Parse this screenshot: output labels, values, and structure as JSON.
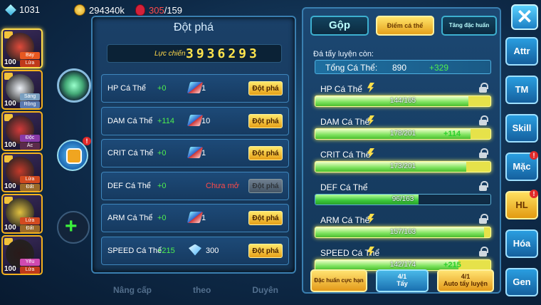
{
  "resources": {
    "gems": "1031",
    "gold": "294340k",
    "energy_current": "305",
    "energy_max": "/159"
  },
  "team": [
    {
      "level": "100",
      "tag1": "Bay",
      "tag2": "Lửa",
      "color1": "#e85820",
      "color2": "#c03a1a",
      "avatar": "#e04a3a"
    },
    {
      "level": "100",
      "tag1": "Sáng",
      "tag2": "Rồng",
      "color1": "#7aa0c0",
      "color2": "#5a7ab0",
      "avatar": "#eef2f8"
    },
    {
      "level": "100",
      "tag1": "Độc",
      "tag2": "Ác",
      "color1": "#8a3aa8",
      "color2": "#5a2a4a",
      "avatar": "#d23a3a"
    },
    {
      "level": "100",
      "tag1": "Lửa",
      "tag2": "Đất",
      "color1": "#d24a20",
      "color2": "#9a6a2a",
      "avatar": "#c43a2a"
    },
    {
      "level": "100",
      "tag1": "Lửa",
      "tag2": "Đất",
      "color1": "#d24a20",
      "color2": "#9a6a2a",
      "avatar": "#e0c040"
    },
    {
      "level": "100",
      "tag1": "Yêu",
      "tag2": "Lửa",
      "color1": "#d04ab0",
      "color2": "#c03a1a",
      "avatar": "#2a1a1a"
    }
  ],
  "bag_notif": "!",
  "bottom_faded": [
    "Nâng cấp",
    "theo",
    "Duyên"
  ],
  "breakthrough": {
    "title": "Đột phá",
    "power_label": "Lực chiến",
    "power_value": "3936293",
    "rows": [
      {
        "stat": "HP Cá Thể",
        "inc": "+0",
        "cost_icon": "scroll-icon",
        "cost": "1",
        "button": "Đột phá",
        "locked": false
      },
      {
        "stat": "DAM Cá Thể",
        "inc": "+114",
        "cost_icon": "scroll-icon",
        "cost": "10",
        "button": "Đột phá",
        "locked": false
      },
      {
        "stat": "CRIT Cá Thể",
        "inc": "+0",
        "cost_icon": "scroll-icon",
        "cost": "1",
        "button": "Đột phá",
        "locked": false
      },
      {
        "stat": "DEF Cá Thể",
        "inc": "+0",
        "cost_icon": "",
        "cost": "",
        "locked_text": "Chưa mở",
        "button": "Đột phá",
        "locked": true
      },
      {
        "stat": "ARM Cá Thể",
        "inc": "+0",
        "cost_icon": "scroll-icon",
        "cost": "1",
        "button": "Đột phá",
        "locked": false
      },
      {
        "stat": "SPEED Cá Thể",
        "inc": "+215",
        "cost_icon": "diamond-icon",
        "cost": "300",
        "button": "Đột phá",
        "locked": false
      }
    ]
  },
  "stats_panel": {
    "tabs": {
      "merge": "Gộp",
      "individual": "Điểm cá thể",
      "special": "Tăng đặc huấn"
    },
    "points_label": "Đá tẩy luyện còn:",
    "total_label": "Tổng Cá Thể:",
    "total_value": "890",
    "total_gain": "+329",
    "stats": [
      {
        "name": "HP Cá Thể",
        "value": "144/165",
        "ratio": 0.873,
        "add": "",
        "boost": true
      },
      {
        "name": "DAM Cá Thể",
        "value": "178/201",
        "ratio": 0.886,
        "add": "+114",
        "boost": true
      },
      {
        "name": "CRIT Cá Thể",
        "value": "173/201",
        "ratio": 0.861,
        "add": "",
        "boost": true
      },
      {
        "name": "DEF Cá Thể",
        "value": "96/163",
        "ratio": 0.589,
        "add": "",
        "boost": false
      },
      {
        "name": "ARM Cá Thể",
        "value": "157/163",
        "ratio": 0.963,
        "add": "",
        "boost": true
      },
      {
        "name": "SPEED Cá Thể",
        "value": "142/174",
        "ratio": 0.816,
        "add": "+215",
        "boost": true
      }
    ],
    "buttons": {
      "special_train": "Đặc huấn cực hạn",
      "wash_count": "4/1",
      "wash_label": "Tẩy",
      "auto_count": "4/1",
      "auto_label": "Auto tẩy luyện"
    }
  },
  "nav": [
    {
      "label": "Attr",
      "notif": ""
    },
    {
      "label": "TM",
      "notif": ""
    },
    {
      "label": "Skill",
      "notif": ""
    },
    {
      "label": "Mặc",
      "notif": "!"
    },
    {
      "label": "HL",
      "notif": "!"
    },
    {
      "label": "Hóa",
      "notif": ""
    },
    {
      "label": "Gen",
      "notif": ""
    }
  ],
  "close_label": "✕"
}
